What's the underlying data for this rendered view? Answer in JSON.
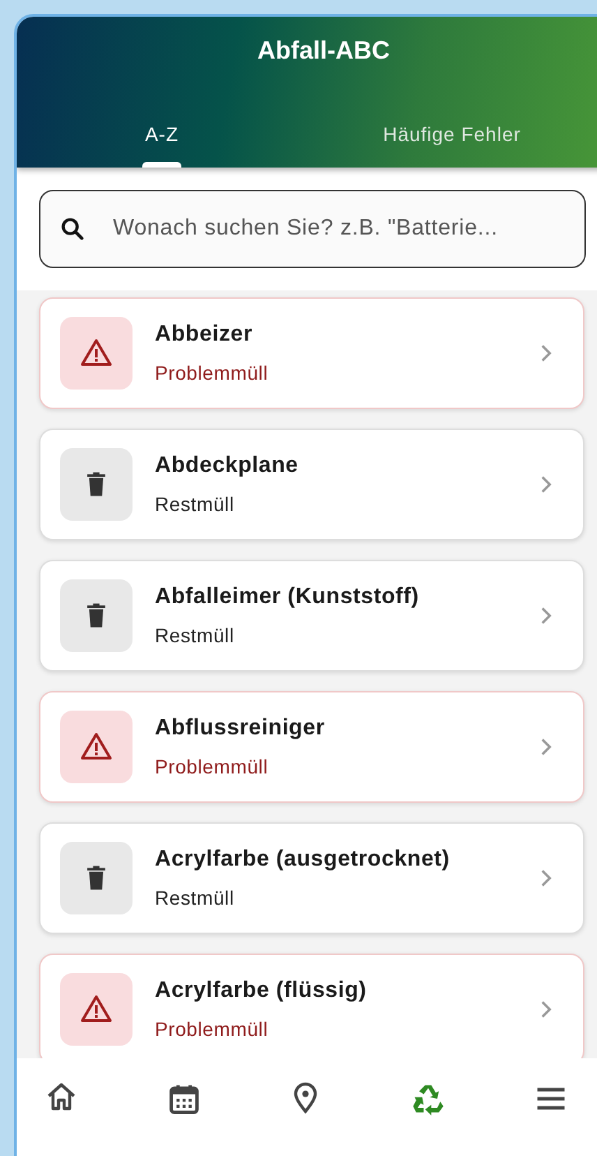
{
  "header": {
    "title": "Abfall-ABC"
  },
  "tabs": [
    {
      "label": "A-Z",
      "selected": true
    },
    {
      "label": "Häufige Fehler",
      "selected": false
    }
  ],
  "search": {
    "placeholder": "Wonach suchen Sie? z.B. \"Batterie..."
  },
  "items": [
    {
      "name": "Abbeizer",
      "category": "Problemmüll",
      "kind": "hazard"
    },
    {
      "name": "Abdeckplane",
      "category": "Restmüll",
      "kind": "residual"
    },
    {
      "name": "Abfalleimer (Kunststoff)",
      "category": "Restmüll",
      "kind": "residual"
    },
    {
      "name": "Abflussreiniger",
      "category": "Problemmüll",
      "kind": "hazard"
    },
    {
      "name": "Acrylfarbe (ausgetrocknet)",
      "category": "Restmüll",
      "kind": "residual"
    },
    {
      "name": "Acrylfarbe (flüssig)",
      "category": "Problemmüll",
      "kind": "hazard"
    }
  ],
  "nav": [
    {
      "kind": "home",
      "selected": false
    },
    {
      "kind": "calendar",
      "selected": false
    },
    {
      "kind": "location",
      "selected": false
    },
    {
      "kind": "recycle",
      "selected": true
    },
    {
      "kind": "menu",
      "selected": false
    }
  ]
}
